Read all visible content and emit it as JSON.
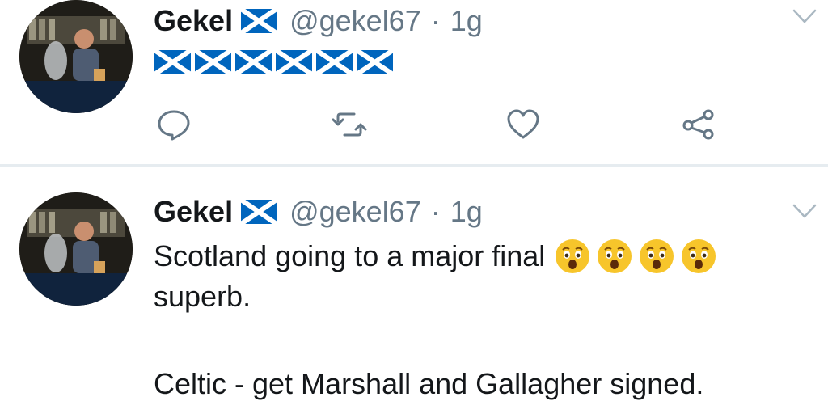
{
  "tweets": [
    {
      "name": "Gekel",
      "handle": "@gekel67",
      "separator": "·",
      "time": "1g",
      "flag_emoji_count": 6,
      "actions": [
        "reply-icon",
        "retweet-icon",
        "like-icon",
        "share-icon"
      ]
    },
    {
      "name": "Gekel",
      "handle": "@gekel67",
      "separator": "·",
      "time": "1g",
      "text_line1": "Scotland going to a major final",
      "text_line2": "superb.",
      "text_line3": "Celtic - get Marshall and Gallagher signed.",
      "emoji_count": 4
    }
  ],
  "colors": {
    "name": "#14171a",
    "secondary": "#657786",
    "flag_blue": "#0065bd",
    "divider": "#e6ecf0",
    "emoji_yellow": "#f7c52b"
  }
}
